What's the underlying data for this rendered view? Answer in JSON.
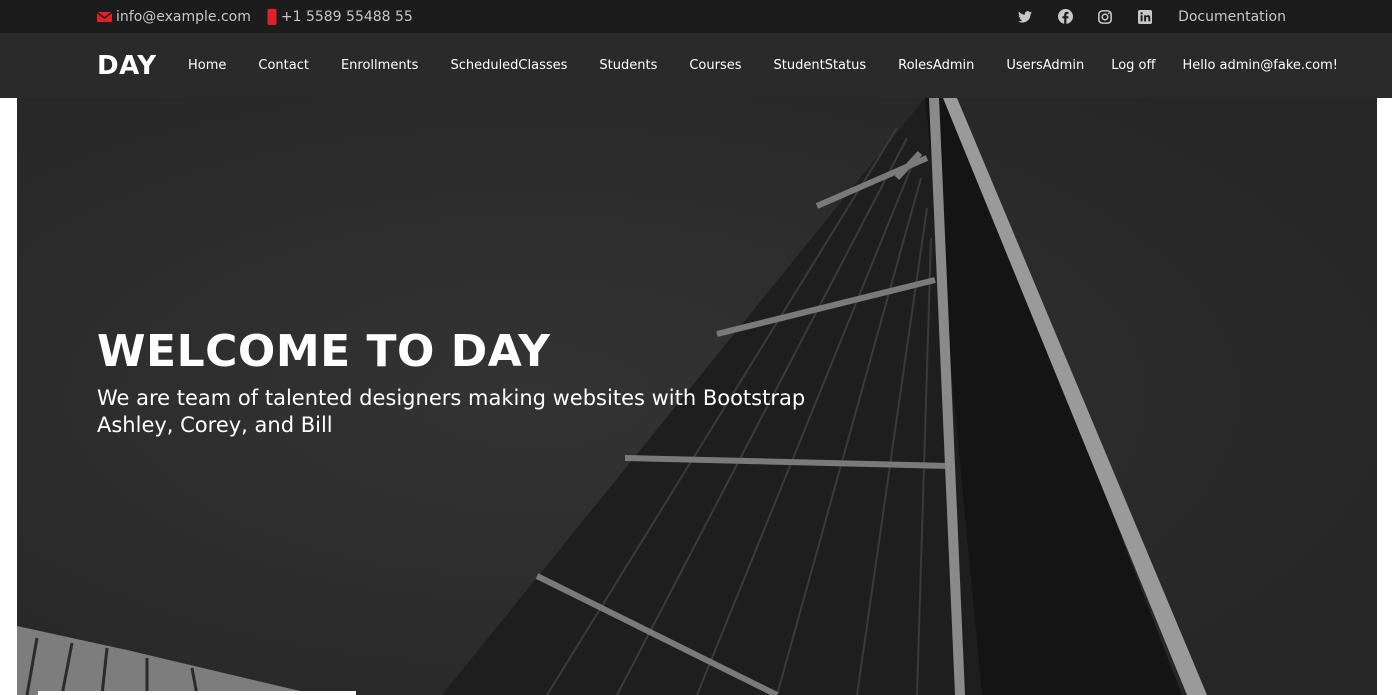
{
  "topbar": {
    "email": "info@example.com",
    "phone": "+1 5589 55488 55",
    "social_icons": [
      "twitter-icon",
      "facebook-icon",
      "instagram-icon",
      "linkedin-icon"
    ],
    "documentation_label": "Documentation",
    "icon_color": "#e0212b"
  },
  "navbar": {
    "brand": "DAY",
    "items": [
      {
        "label": "Home"
      },
      {
        "label": "Contact"
      },
      {
        "label": "Enrollments"
      },
      {
        "label": "ScheduledClasses"
      },
      {
        "label": "Students"
      },
      {
        "label": "Courses"
      },
      {
        "label": "StudentStatus"
      },
      {
        "label": "RolesAdmin"
      },
      {
        "label": "UsersAdmin"
      },
      {
        "label": "Log off"
      },
      {
        "label": "Hello admin@fake.com!"
      }
    ]
  },
  "hero": {
    "title": "WELCOME TO DAY",
    "subtitle": "We are team of talented designers making websites with Bootstrap Ashley, Corey, and Bill"
  }
}
